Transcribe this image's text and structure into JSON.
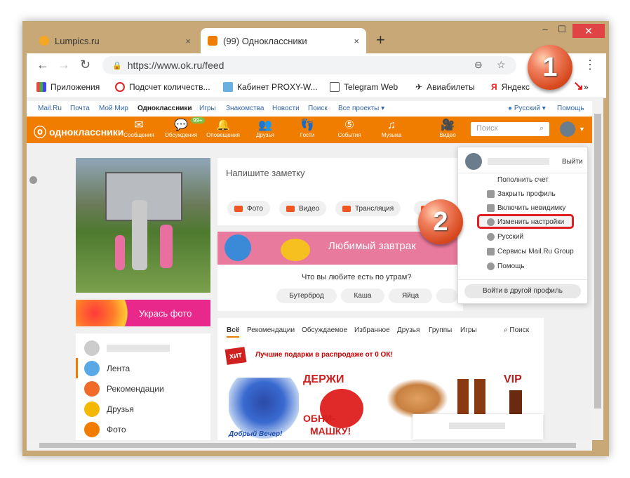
{
  "browser": {
    "tabs": [
      {
        "label": "Lumpics.ru",
        "close": "×"
      },
      {
        "label": "(99) Одноклассники",
        "close": "×"
      }
    ],
    "new_tab": "+",
    "window_controls": {
      "minimize": "–",
      "maximize": "☐",
      "close": "✕"
    },
    "url": "https://www.ok.ru/feed",
    "bookmarks": [
      "Приложения",
      "Подсчет количеств...",
      "Кабинет PROXY-W...",
      "Telegram Web",
      "Авиабилеты",
      "Яндекс"
    ],
    "bookmarks_more": "»"
  },
  "ok_top_links": [
    "Mail.Ru",
    "Почта",
    "Мой Мир",
    "Одноклассники",
    "Игры",
    "Знакомства",
    "Новости",
    "Поиск",
    "Все проекты ▾"
  ],
  "language": "Русский ▾",
  "help_link": "Помощь",
  "ok_nav": {
    "logo": "одноклассники",
    "items": [
      "Сообщения",
      "Обсуждения",
      "Оповещения",
      "Друзья",
      "Гости",
      "События",
      "Музыка",
      "Видео"
    ],
    "discussions_badge": "99+",
    "search_placeholder": "Поиск"
  },
  "decorate_button": "Укрась фото",
  "sidebar": [
    {
      "label": "Лента",
      "color": "#5aa9e6"
    },
    {
      "label": "Рекомендации",
      "color": "#f06a2a"
    },
    {
      "label": "Друзья",
      "color": "#f5b800"
    },
    {
      "label": "Фото",
      "color": "#f07d00"
    }
  ],
  "composer": {
    "placeholder": "Напишите заметку",
    "actions": [
      "Фото",
      "Видео",
      "Трансляция"
    ]
  },
  "breakfast": {
    "title": "Любимый завтрак",
    "question": "Что вы любите есть по утрам?",
    "choices": [
      "Бутерброд",
      "Каша",
      "Яйца"
    ]
  },
  "feed_tabs": [
    "Всё",
    "Рекомендации",
    "Обсуждаемое",
    "Избранное",
    "Друзья",
    "Группы",
    "Игры"
  ],
  "feed_search": "Поиск",
  "gift_banner": "Лучшие подарки в распродаже от 0 ОК!",
  "gift_badge": "ХИТ",
  "gift_texts": {
    "hold": "ДЕРЖИ",
    "hug": "ОБНИ-",
    "hug2": "МАШКУ!",
    "evening": "Добрый Вечер!",
    "vip": "VIP"
  },
  "profile_menu": {
    "logout": "Выйти",
    "items": [
      "Пополнить счет",
      "Закрыть профиль",
      "Включить невидимку",
      "Изменить настройки",
      "Русский",
      "Сервисы Mail.Ru Group",
      "Помощь"
    ],
    "login_other": "Войти в другой профиль"
  },
  "callouts": [
    "1",
    "2"
  ]
}
